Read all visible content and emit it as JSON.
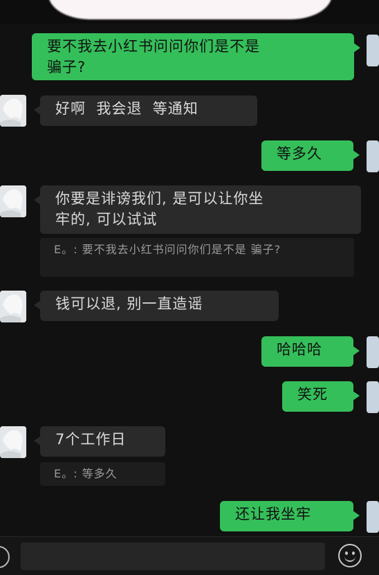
{
  "chat": {
    "messages": [
      {
        "side": "out",
        "text": "要不我去小红书问问你们是不是\n骗子?"
      },
      {
        "side": "in",
        "text": "好啊  我会退  等通知"
      },
      {
        "side": "out",
        "text": "等多久"
      },
      {
        "side": "in",
        "text": "你要是诽谤我们, 是可以让你坐\n牢的, 可以试试",
        "quote": "E。: 要不我去小红书问问你们是不是\n骗子?"
      },
      {
        "side": "in",
        "text": "钱可以退, 别一直造谣"
      },
      {
        "side": "out",
        "text": "哈哈哈"
      },
      {
        "side": "out",
        "text": "笑死"
      },
      {
        "side": "in",
        "text": "7个工作日",
        "quote": "E。: 等多久"
      },
      {
        "side": "out",
        "text": "还让我坐牢"
      }
    ]
  },
  "input_bar": {
    "voice_icon": "voice-icon",
    "emoji_icon": "emoji-icon"
  },
  "colors": {
    "background": "#111111",
    "outgoing_bubble": "#35bf5a",
    "incoming_bubble": "#2a2a2a"
  }
}
